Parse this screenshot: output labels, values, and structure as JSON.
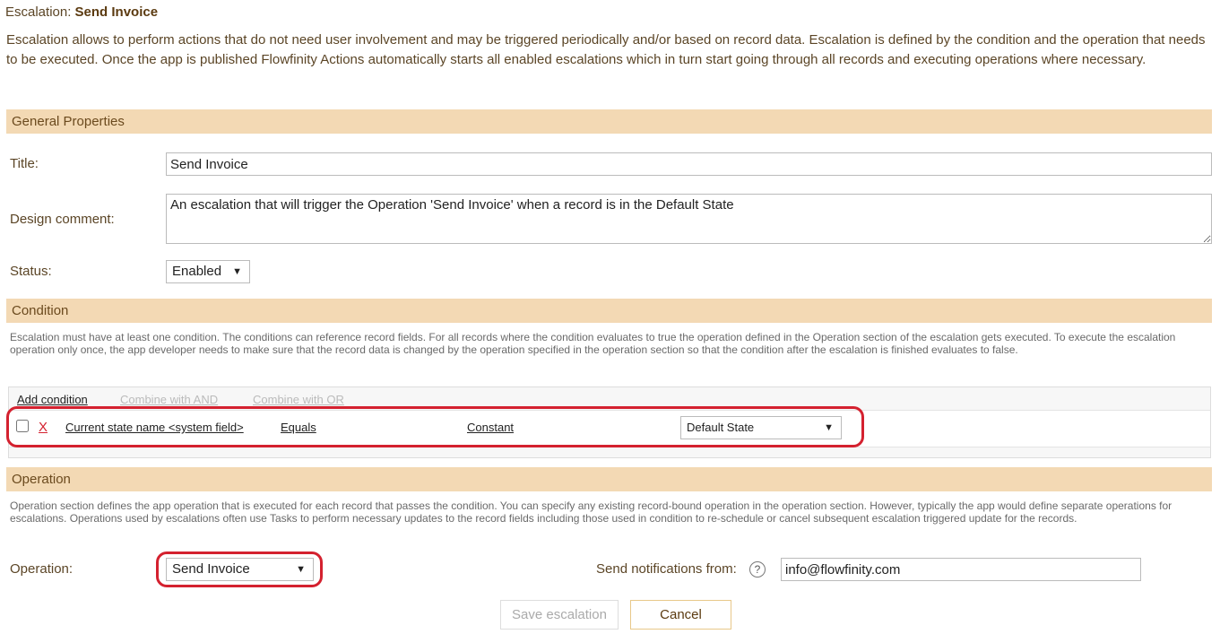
{
  "header": {
    "prefix": "Escalation: ",
    "name": "Send Invoice"
  },
  "intro": "Escalation allows to perform actions that do not need user involvement and may be triggered periodically and/or based on record data. Escalation is defined by the condition and the operation that needs to be executed. Once the app is published Flowfinity Actions automatically starts all enabled escalations which in turn start going through all records and executing operations where necessary.",
  "general": {
    "heading": "General Properties",
    "title_label": "Title:",
    "title_value": "Send Invoice",
    "comment_label": "Design comment:",
    "comment_value": "An escalation that will trigger the Operation 'Send Invoice' when a record is in the Default State",
    "status_label": "Status:",
    "status_value": "Enabled"
  },
  "condition": {
    "heading": "Condition",
    "help": "Escalation must have at least one condition. The conditions can reference record fields. For all records where the condition evaluates to true the operation defined in the Operation section of the escalation gets executed. To execute the escalation operation only once, the app developer needs to make sure that the record data is changed by the operation specified in the operation section so that the condition after the escalation is finished evaluates to false.",
    "add": "Add condition",
    "and": "Combine with AND",
    "or": "Combine with OR",
    "row": {
      "remove": "X",
      "field": "Current state name <system field>",
      "operator": "Equals",
      "type": "Constant",
      "value": "Default State"
    }
  },
  "operation": {
    "heading": "Operation",
    "help": "Operation section defines the app operation that is executed for each record that passes the condition. You can specify any existing record-bound operation in the operation section. However, typically the app would define separate operations for escalations. Operations used by escalations often use Tasks to perform necessary updates to the record fields including those used in condition to re-schedule or cancel subsequent escalation triggered update for the records.",
    "label": "Operation:",
    "value": "Send Invoice",
    "notify_label": "Send notifications from:",
    "notify_value": "info@flowfinity.com",
    "help_icon": "?"
  },
  "buttons": {
    "save": "Save escalation",
    "cancel": "Cancel"
  },
  "colors": {
    "section": "#f3d9b4",
    "highlight": "#d4212f"
  }
}
